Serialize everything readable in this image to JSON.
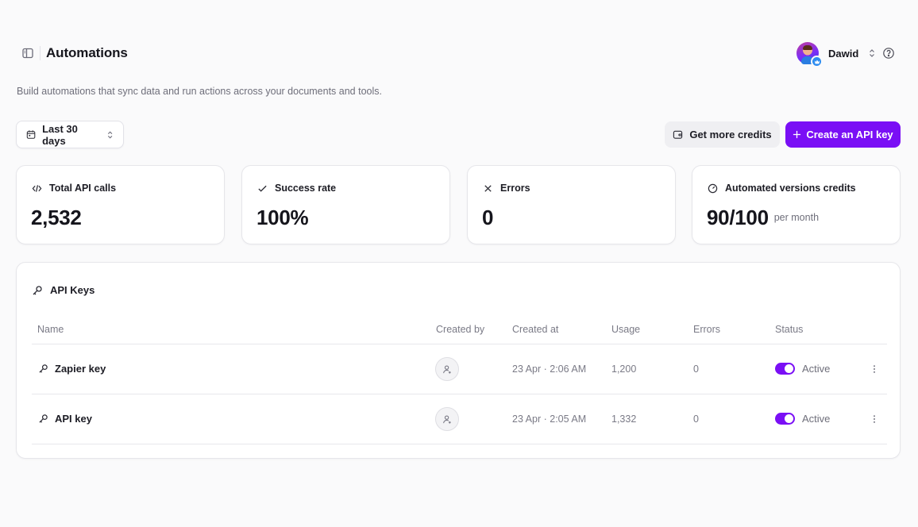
{
  "header": {
    "title": "Automations",
    "user_name": "Dawid"
  },
  "subtitle": "Build automations that sync data and run actions across your documents and tools.",
  "toolbar": {
    "date_range": "Last 30 days",
    "credits_label": "Get more credits",
    "create_label": "Create an API key",
    "accent": "#7a0ff5"
  },
  "stats": [
    {
      "label": "Total API calls",
      "value": "2,532",
      "icon": "code-icon"
    },
    {
      "label": "Success rate",
      "value": "100%",
      "icon": "check-icon"
    },
    {
      "label": "Errors",
      "value": "0",
      "icon": "x-icon"
    },
    {
      "label": "Automated versions credits",
      "value": "90/100",
      "suffix": "per month",
      "icon": "gauge-icon"
    }
  ],
  "api_keys": {
    "title": "API Keys",
    "columns": [
      "Name",
      "Created by",
      "Created at",
      "Usage",
      "Errors",
      "Status"
    ],
    "rows": [
      {
        "name": "Zapier key",
        "created_at": "23 Apr · 2:06 AM",
        "usage": "1,200",
        "errors": "0",
        "status": "Active"
      },
      {
        "name": "API key",
        "created_at": "23 Apr · 2:05 AM",
        "usage": "1,332",
        "errors": "0",
        "status": "Active"
      }
    ]
  }
}
